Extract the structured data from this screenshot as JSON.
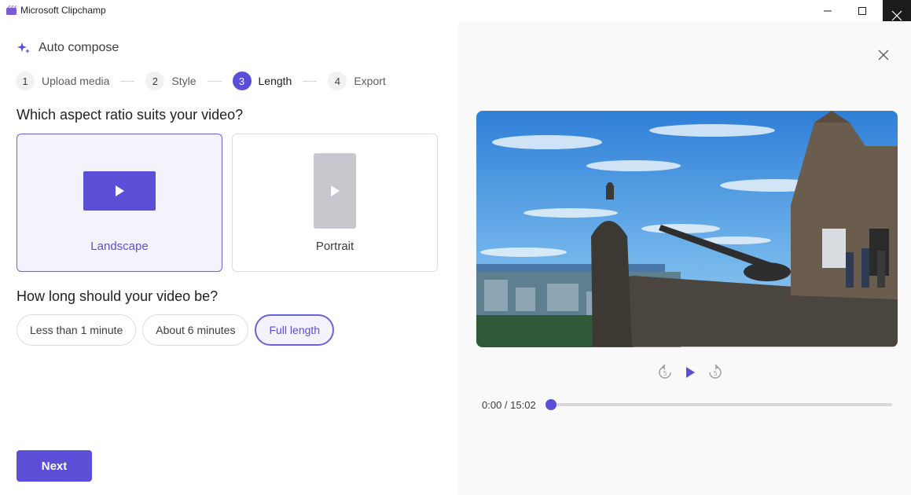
{
  "window": {
    "title": "Microsoft Clipchamp",
    "controls": [
      "minimize-icon",
      "maximize-icon",
      "close-icon"
    ]
  },
  "header": {
    "icon": "sparkle-icon",
    "title": "Auto compose"
  },
  "steps": [
    {
      "number": "1",
      "label": "Upload media",
      "active": false
    },
    {
      "number": "2",
      "label": "Style",
      "active": false
    },
    {
      "number": "3",
      "label": "Length",
      "active": true
    },
    {
      "number": "4",
      "label": "Export",
      "active": false
    }
  ],
  "aspect": {
    "question": "Which aspect ratio suits your video?",
    "options": [
      {
        "label": "Landscape",
        "selected": true
      },
      {
        "label": "Portrait",
        "selected": false
      }
    ]
  },
  "length": {
    "question": "How long should your video be?",
    "options": [
      {
        "label": "Less than 1 minute",
        "selected": false
      },
      {
        "label": "About 6 minutes",
        "selected": false
      },
      {
        "label": "Full length",
        "selected": true
      }
    ]
  },
  "footer": {
    "next_label": "Next"
  },
  "preview": {
    "close_icon": "close-icon",
    "controls": [
      "rewind-5-icon",
      "play-icon",
      "forward-5-icon"
    ],
    "time_label": "0:00 / 15:02",
    "progress": 0.0
  },
  "colors": {
    "accent": "#5b4fd8",
    "selected_bg": "#f4f2fd",
    "panel_bg": "#f9f9fa"
  }
}
